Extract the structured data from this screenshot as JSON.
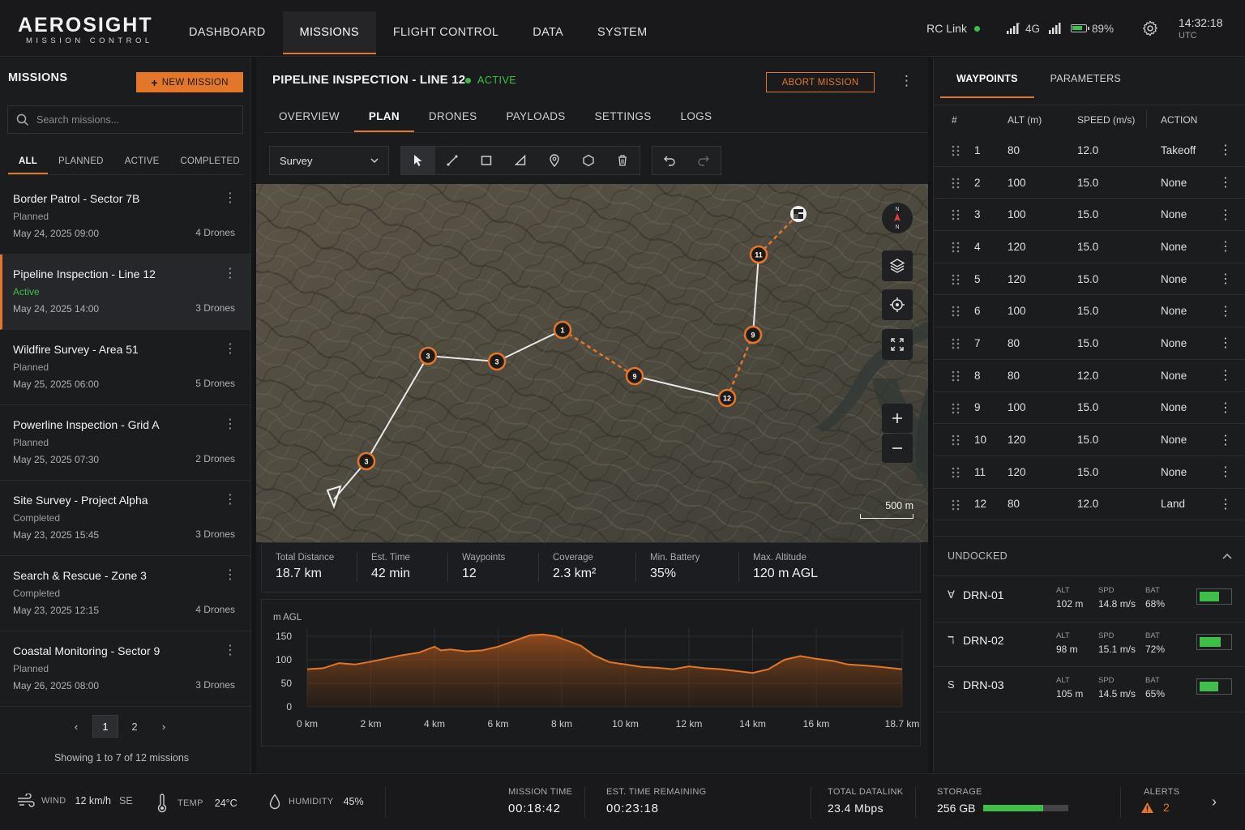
{
  "app": {
    "logo_main": "AEROSIGHT",
    "logo_sub": "MISSION CONTROL",
    "nav": [
      "DASHBOARD",
      "MISSIONS",
      "FLIGHT CONTROL",
      "DATA",
      "SYSTEM"
    ],
    "active_nav": "MISSIONS",
    "rc_link": "RC Link",
    "signal": "4G",
    "battery": "89%",
    "time": "14:32:18",
    "tz": "UTC"
  },
  "left": {
    "title": "MISSIONS",
    "new_mission": "NEW MISSION",
    "search_placeholder": "Search missions...",
    "filters": [
      "ALL",
      "PLANNED",
      "ACTIVE",
      "COMPLETED"
    ],
    "missions": [
      {
        "title": "Border Patrol - Sector 7B",
        "status": "Planned",
        "date": "May 24, 2025 09:00",
        "drones": "4 Drones"
      },
      {
        "title": "Pipeline Inspection - Line 12",
        "status": "Active",
        "date": "May 24, 2025 14:00",
        "drones": "3 Drones"
      },
      {
        "title": "Wildfire Survey - Area 51",
        "status": "Planned",
        "date": "May 25, 2025 06:00",
        "drones": "5 Drones"
      },
      {
        "title": "Powerline Inspection - Grid A",
        "status": "Planned",
        "date": "May 25, 2025 07:30",
        "drones": "2 Drones"
      },
      {
        "title": "Site Survey - Project Alpha",
        "status": "Completed",
        "date": "May 23, 2025 15:45",
        "drones": "3 Drones"
      },
      {
        "title": "Search & Rescue - Zone 3",
        "status": "Completed",
        "date": "May 23, 2025 12:15",
        "drones": "4 Drones"
      },
      {
        "title": "Coastal Monitoring - Sector 9",
        "status": "Planned",
        "date": "May 26, 2025 08:00",
        "drones": "3 Drones"
      }
    ],
    "pages": [
      "1",
      "2"
    ],
    "showing": "Showing 1 to 7 of 12 missions"
  },
  "center": {
    "mission_title": "PIPELINE INSPECTION - LINE 12",
    "status": "ACTIVE",
    "abort": "ABORT MISSION",
    "tabs": [
      "OVERVIEW",
      "PLAN",
      "DRONES",
      "PAYLOADS",
      "SETTINGS",
      "LOGS"
    ],
    "active_tab": "PLAN",
    "survey_select": "Survey",
    "compass_n": "N",
    "compass_s": "N",
    "scale": "500 m",
    "markers": [
      "3",
      "3",
      "1",
      "9",
      "12",
      "9",
      "11",
      "3"
    ],
    "stats": [
      {
        "label": "Total Distance",
        "value": "18.7 km"
      },
      {
        "label": "Est. Time",
        "value": "42 min"
      },
      {
        "label": "Waypoints",
        "value": "12"
      },
      {
        "label": "Coverage",
        "value": "2.3 km²"
      },
      {
        "label": "Min. Battery",
        "value": "35%"
      },
      {
        "label": "Max. Altitude",
        "value": "120 m AGL"
      }
    ]
  },
  "chart_data": {
    "type": "area",
    "ylabel": "m AGL",
    "ylim": [
      0,
      150
    ],
    "yticks": [
      "150",
      "100",
      "50",
      "0"
    ],
    "xticks": [
      "0 km",
      "2 km",
      "4 km",
      "6 km",
      "8 km",
      "10 km",
      "12 km",
      "14 km",
      "16 km",
      "18.7 km"
    ],
    "x": [
      0,
      0.5,
      1,
      1.5,
      2,
      2.5,
      3,
      3.5,
      4,
      4.2,
      4.5,
      5,
      5.5,
      6,
      6.5,
      7,
      7.4,
      7.8,
      8.2,
      8.6,
      9,
      9.5,
      10,
      10.5,
      11,
      11.5,
      12,
      12.5,
      13,
      13.5,
      14,
      14.5,
      15,
      15.5,
      16,
      16.5,
      17,
      17.5,
      18,
      18.7
    ],
    "y": [
      80,
      82,
      93,
      90,
      96,
      103,
      110,
      115,
      128,
      120,
      122,
      118,
      120,
      128,
      140,
      152,
      154,
      150,
      140,
      130,
      110,
      95,
      90,
      85,
      83,
      80,
      86,
      82,
      80,
      76,
      72,
      80,
      100,
      108,
      102,
      98,
      90,
      88,
      85,
      80
    ]
  },
  "right": {
    "tabs": [
      "WAYPOINTS",
      "PARAMETERS"
    ],
    "headers": [
      "#",
      "ALT (m)",
      "SPEED (m/s)",
      "ACTION"
    ],
    "waypoints": [
      {
        "n": "1",
        "alt": "80",
        "spd": "12.0",
        "act": "Takeoff"
      },
      {
        "n": "2",
        "alt": "100",
        "spd": "15.0",
        "act": "None"
      },
      {
        "n": "3",
        "alt": "100",
        "spd": "15.0",
        "act": "None"
      },
      {
        "n": "4",
        "alt": "120",
        "spd": "15.0",
        "act": "None"
      },
      {
        "n": "5",
        "alt": "120",
        "spd": "15.0",
        "act": "None"
      },
      {
        "n": "6",
        "alt": "100",
        "spd": "15.0",
        "act": "None"
      },
      {
        "n": "7",
        "alt": "80",
        "spd": "15.0",
        "act": "None"
      },
      {
        "n": "8",
        "alt": "80",
        "spd": "12.0",
        "act": "None"
      },
      {
        "n": "9",
        "alt": "100",
        "spd": "15.0",
        "act": "None"
      },
      {
        "n": "10",
        "alt": "120",
        "spd": "15.0",
        "act": "None"
      },
      {
        "n": "11",
        "alt": "120",
        "spd": "15.0",
        "act": "None"
      },
      {
        "n": "12",
        "alt": "80",
        "spd": "12.0",
        "act": "Land"
      }
    ],
    "undocked": "UNDOCKED",
    "drone_keys": [
      "ALT",
      "SPD",
      "BAT"
    ],
    "drones": [
      {
        "icon": "∀",
        "name": "DRN-01",
        "alt": "102 m",
        "spd": "14.8 m/s",
        "bat": "68%",
        "level": 0.68
      },
      {
        "icon": "ℸ",
        "name": "DRN-02",
        "alt": "98 m",
        "spd": "15.1 m/s",
        "bat": "72%",
        "level": 0.72
      },
      {
        "icon": "S",
        "name": "DRN-03",
        "alt": "105 m",
        "spd": "14.5 m/s",
        "bat": "65%",
        "level": 0.65
      }
    ]
  },
  "bottom": {
    "wind_label": "WIND",
    "wind": "12 km/h",
    "wind_dir": "SE",
    "temp_label": "TEMP",
    "temp": "24°C",
    "humidity_label": "HUMIDITY",
    "humidity": "45%",
    "mission_time_label": "MISSION TIME",
    "mission_time": "00:18:42",
    "remaining_label": "EST. TIME REMAINING",
    "remaining": "00:23:18",
    "datalink_label": "TOTAL DATALINK",
    "datalink": "23.4 Mbps",
    "storage_label": "STORAGE",
    "storage": "256 GB",
    "storage_level": 0.7,
    "alerts_label": "ALERTS",
    "alerts": "2"
  },
  "colors": {
    "accent": "#e2762b",
    "success": "#3fbf4a",
    "bg": "#141516"
  }
}
